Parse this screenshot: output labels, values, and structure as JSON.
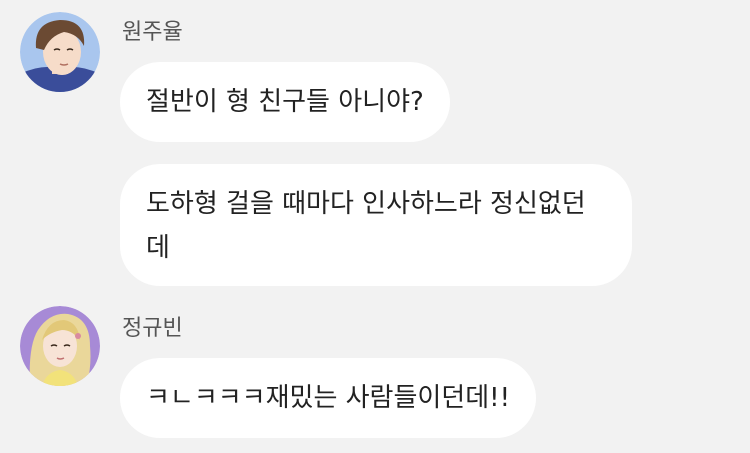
{
  "colors": {
    "background": "#f2f2f2",
    "bubble": "#ffffff",
    "sender_name": "#555555",
    "message_text": "#222222"
  },
  "messages": [
    {
      "sender": "원주율",
      "avatar": "male-avatar-icon",
      "bubbles": [
        "절반이 형 친구들 아니야?",
        "도하형 걸을 때마다 인사하느라 정신없던데"
      ]
    },
    {
      "sender": "정규빈",
      "avatar": "female-avatar-icon",
      "bubbles": [
        "ㅋㄴㅋㅋㅋ재밌는 사람들이던데!!"
      ]
    }
  ]
}
